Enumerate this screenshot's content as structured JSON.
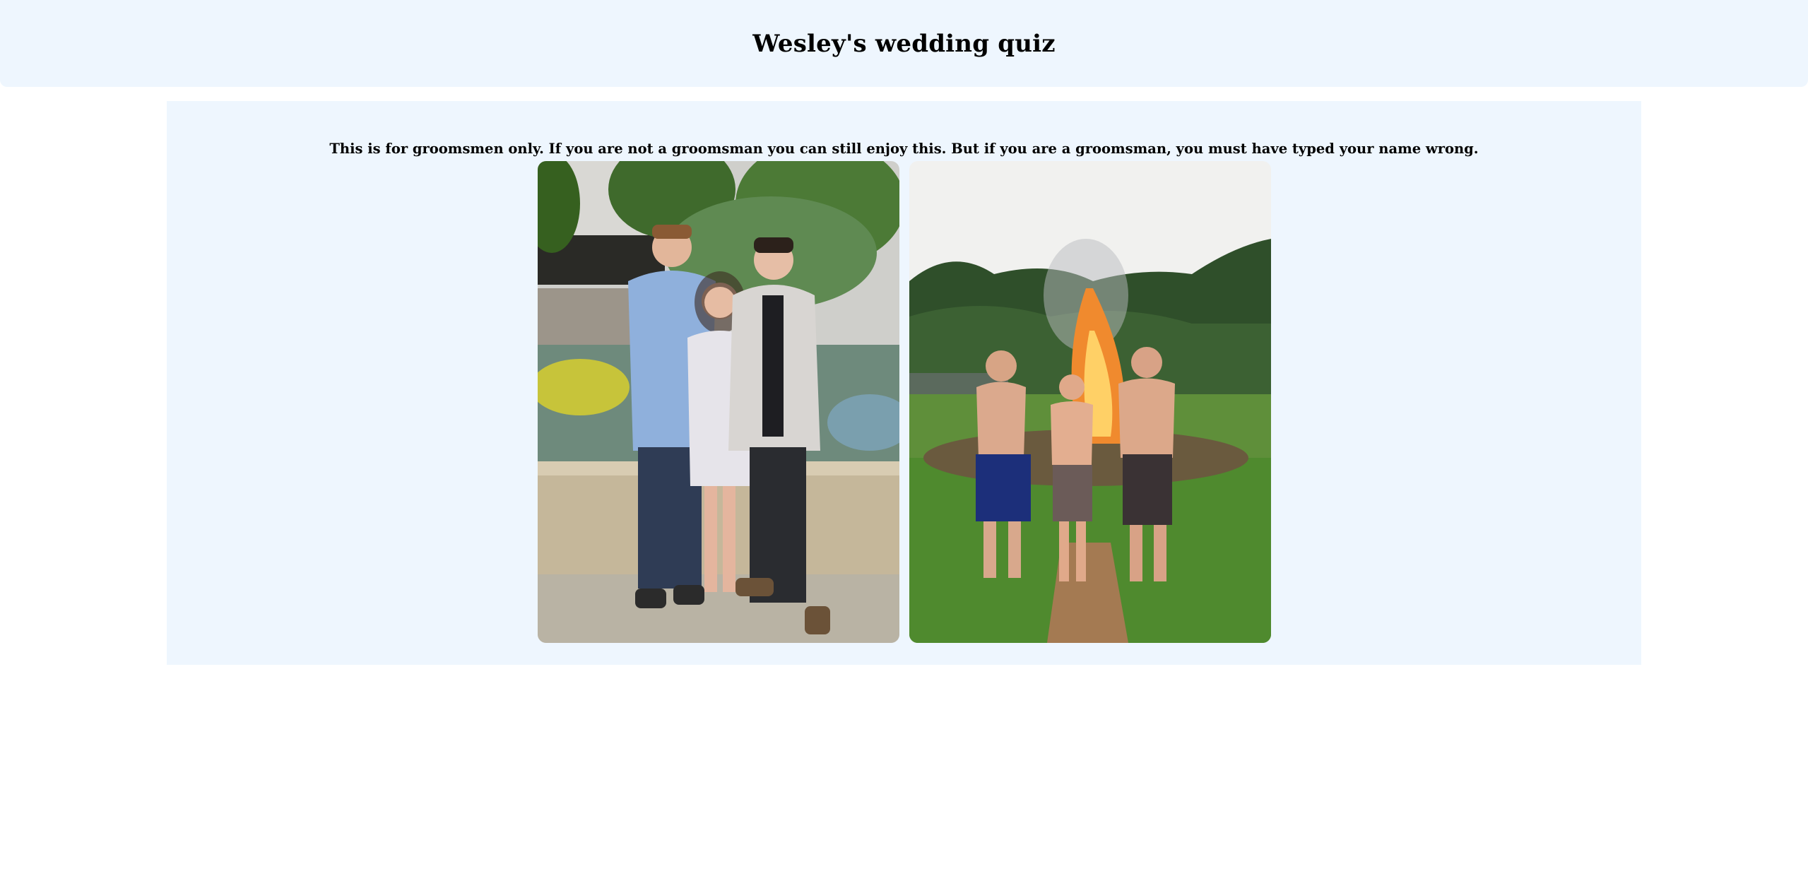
{
  "header": {
    "title": "Wesley's wedding quiz"
  },
  "main": {
    "notice": "This is for groomsmen only. If you are not a groomsman you can still enjoy this. But if you are a groomsman, you must have typed your name wrong.",
    "photos": [
      {
        "description_icon": "photo-garden-trio"
      },
      {
        "description_icon": "photo-bonfire-trio"
      }
    ]
  },
  "colors": {
    "header_bg": "#eef6fe",
    "panel_bg": "#eef6fe",
    "page_bg": "#ffffff"
  }
}
